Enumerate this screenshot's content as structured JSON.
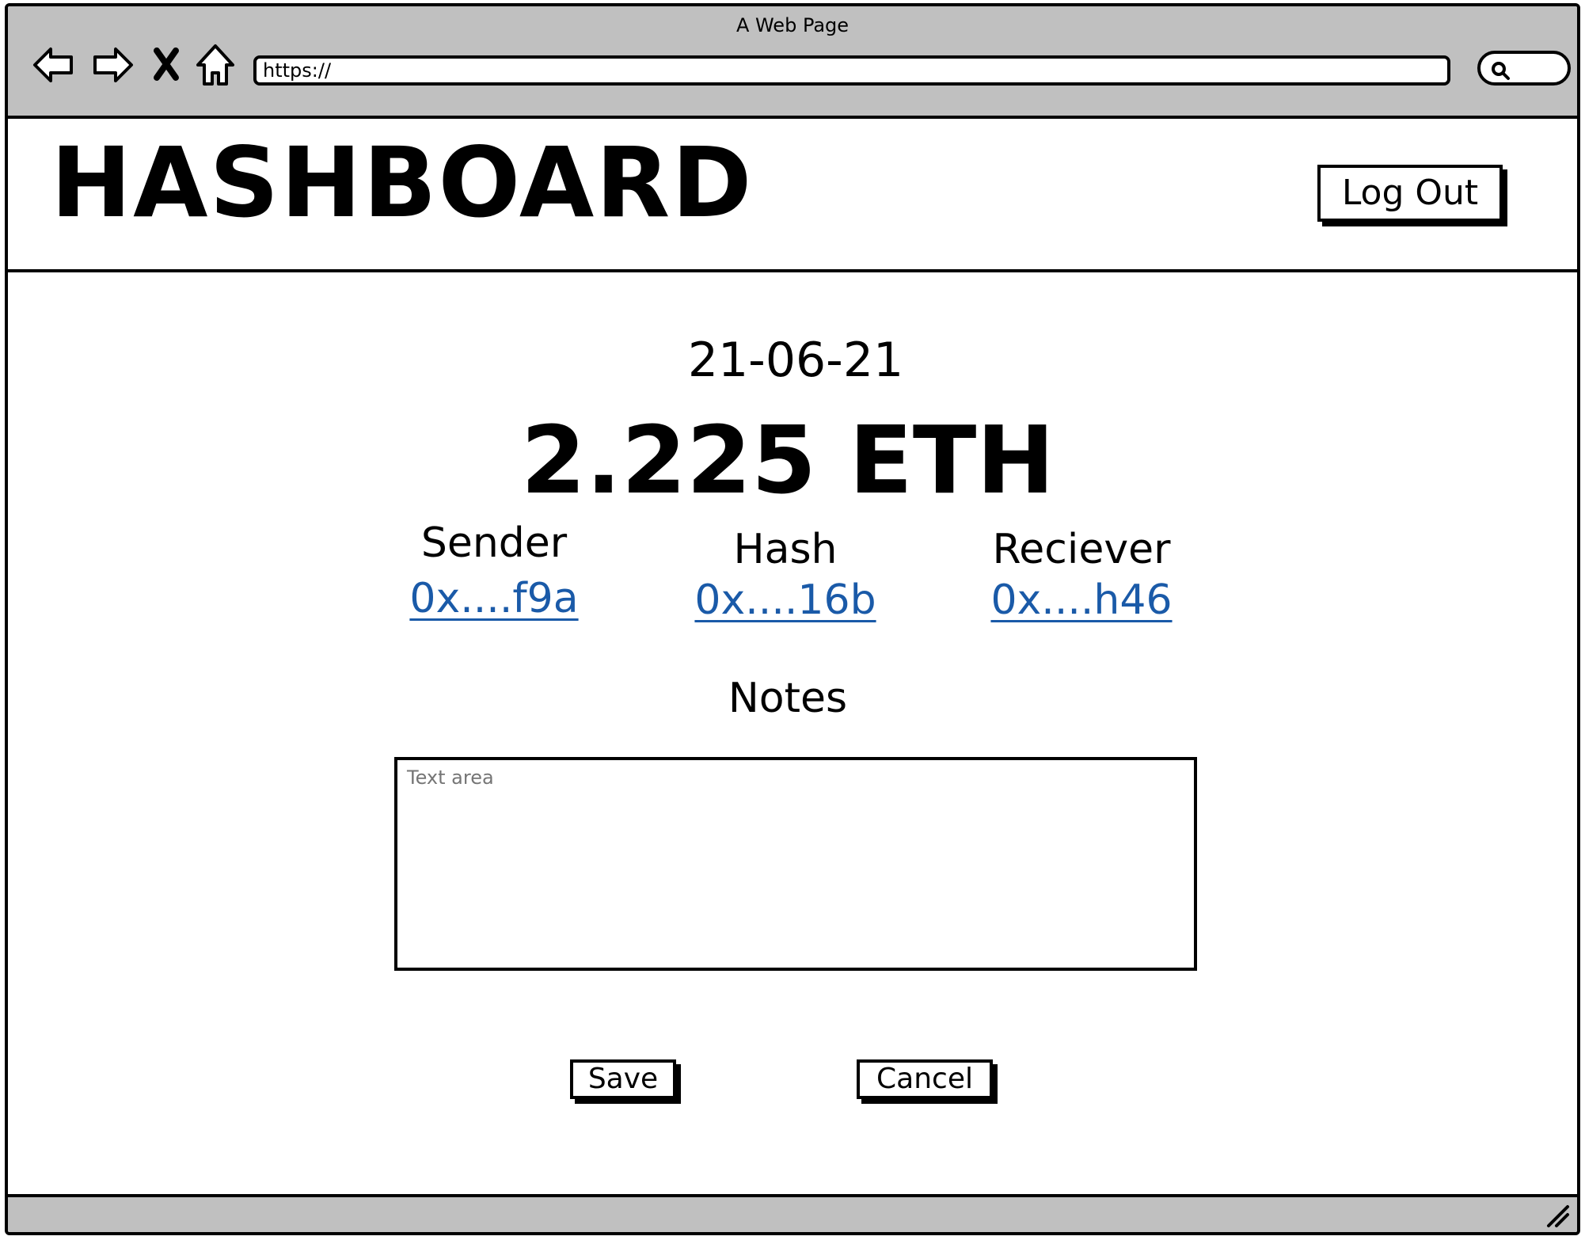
{
  "window": {
    "title": "A Web Page"
  },
  "browser": {
    "url": "https://",
    "icons": [
      "back-arrow-icon",
      "forward-arrow-icon",
      "close-x-icon",
      "home-icon",
      "search-icon",
      "resize-grip-icon"
    ]
  },
  "header": {
    "brand": "HASHBOARD",
    "logout_label": "Log Out"
  },
  "transaction": {
    "date": "21-06-21",
    "amount": "2.225 ETH",
    "columns": [
      {
        "label": "Sender",
        "value": "0x....f9a"
      },
      {
        "label": "Hash",
        "value": "0x....16b"
      },
      {
        "label": "Reciever",
        "value": "0x....h46"
      }
    ]
  },
  "notes": {
    "label": "Notes",
    "placeholder": "Text area"
  },
  "actions": {
    "save_label": "Save",
    "cancel_label": "Cancel"
  },
  "colors": {
    "chrome_gray": "#c0c0c0",
    "link_blue": "#1a5aa8"
  }
}
